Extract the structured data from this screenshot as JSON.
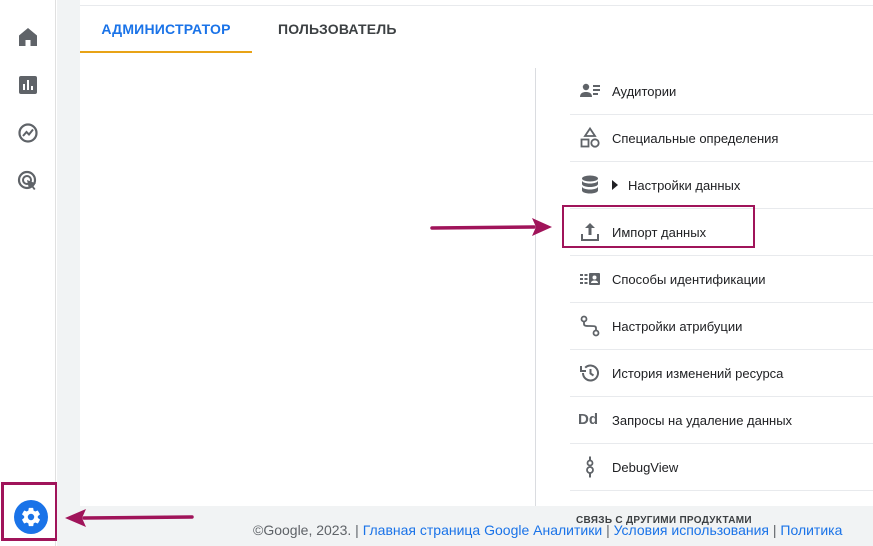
{
  "colors": {
    "accent": "#1a73e8",
    "tab_underline": "#e8a317",
    "annotation": "#a0145a"
  },
  "leftnav": {
    "items": [
      {
        "icon": "home-icon"
      },
      {
        "icon": "reports-icon"
      },
      {
        "icon": "explore-icon"
      },
      {
        "icon": "advertising-icon"
      }
    ],
    "settings_icon": "gear-icon"
  },
  "tabs": {
    "admin": "АДМИНИСТРАТОР",
    "user": "ПОЛЬЗОВАТЕЛЬ"
  },
  "menu": {
    "items": [
      {
        "label": "Аудитории",
        "icon": "audiences-icon"
      },
      {
        "label": "Специальные определения",
        "icon": "shapes-icon"
      },
      {
        "label": "Настройки данных",
        "icon": "database-icon"
      },
      {
        "label": "Импорт данных",
        "icon": "upload-icon"
      },
      {
        "label": "Способы идентификации",
        "icon": "identity-icon"
      },
      {
        "label": "Настройки атрибуции",
        "icon": "attribution-icon"
      },
      {
        "label": "История изменений ресурса",
        "icon": "history-icon"
      },
      {
        "label": "Запросы на удаление данных",
        "icon": "dd-icon",
        "icon_text": "Dd"
      },
      {
        "label": "DebugView",
        "icon": "debugview-icon"
      }
    ],
    "section_heading": "СВЯЗЬ С ДРУГИМИ ПРОДУКТАМИ"
  },
  "footer": {
    "copyright": "©Google, 2023. |",
    "link1": "Главная страница Google Аналитики",
    "sep1": "|",
    "link2": "Условия использования",
    "sep2": "|",
    "link3": "Политика"
  }
}
